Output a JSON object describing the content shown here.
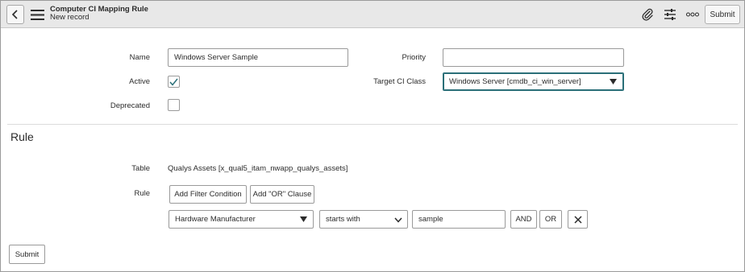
{
  "header": {
    "title": "Computer CI Mapping Rule",
    "subtitle": "New record",
    "submit_label": "Submit",
    "icons": [
      "chevron-left-icon",
      "hamburger-menu-icon",
      "paperclip-icon",
      "sliders-icon",
      "more-icon"
    ]
  },
  "form": {
    "name_label": "Name",
    "name_value": "Windows Server Sample",
    "active_label": "Active",
    "active_checked": true,
    "deprecated_label": "Deprecated",
    "deprecated_checked": false,
    "priority_label": "Priority",
    "priority_value": "",
    "target_label": "Target CI Class",
    "target_value": "Windows Server [cmdb_ci_win_server]"
  },
  "rule_section": {
    "title": "Rule",
    "table_label": "Table",
    "table_value": "Qualys Assets [x_qual5_itam_nwapp_qualys_assets]",
    "rule_label": "Rule",
    "add_filter_label": "Add Filter Condition",
    "add_or_label": "Add \"OR\" Clause",
    "condition": {
      "field": "Hardware Manufacturer",
      "operator": "starts with",
      "value": "sample",
      "and_label": "AND",
      "or_label": "OR"
    }
  },
  "footer": {
    "submit_label": "Submit"
  },
  "colors": {
    "header_bg": "#e8e8e8",
    "accent_focus": "#2a6f78",
    "checkbox_check": "#2a6f78"
  }
}
